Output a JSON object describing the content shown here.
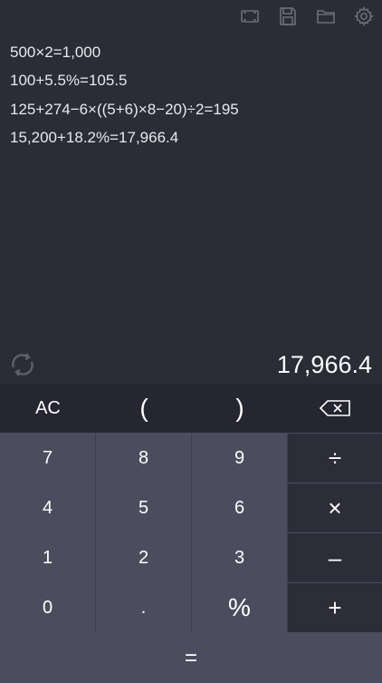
{
  "toolbar": {
    "icons": [
      "fullscreen-icon",
      "save-icon",
      "folder-icon",
      "gear-icon"
    ]
  },
  "history": [
    "500×2=1,000",
    "100+5.5%=105.5",
    "125+274−6×((5+6)×8−20)÷2=195",
    "15,200+18.2%=17,966.4"
  ],
  "result": {
    "value": "17,966.4"
  },
  "keypad": {
    "ac": "AC",
    "open_paren": "(",
    "close_paren": ")",
    "divide": "÷",
    "multiply": "×",
    "minus": "–",
    "plus": "+",
    "percent": "%",
    "decimal": ".",
    "equals": "=",
    "digits": [
      "0",
      "1",
      "2",
      "3",
      "4",
      "5",
      "6",
      "7",
      "8",
      "9"
    ]
  },
  "colors": {
    "background": "#2a2c36",
    "key_number": "#4b4d5e",
    "key_function": "#252631",
    "key_operator": "#2c2d38"
  }
}
